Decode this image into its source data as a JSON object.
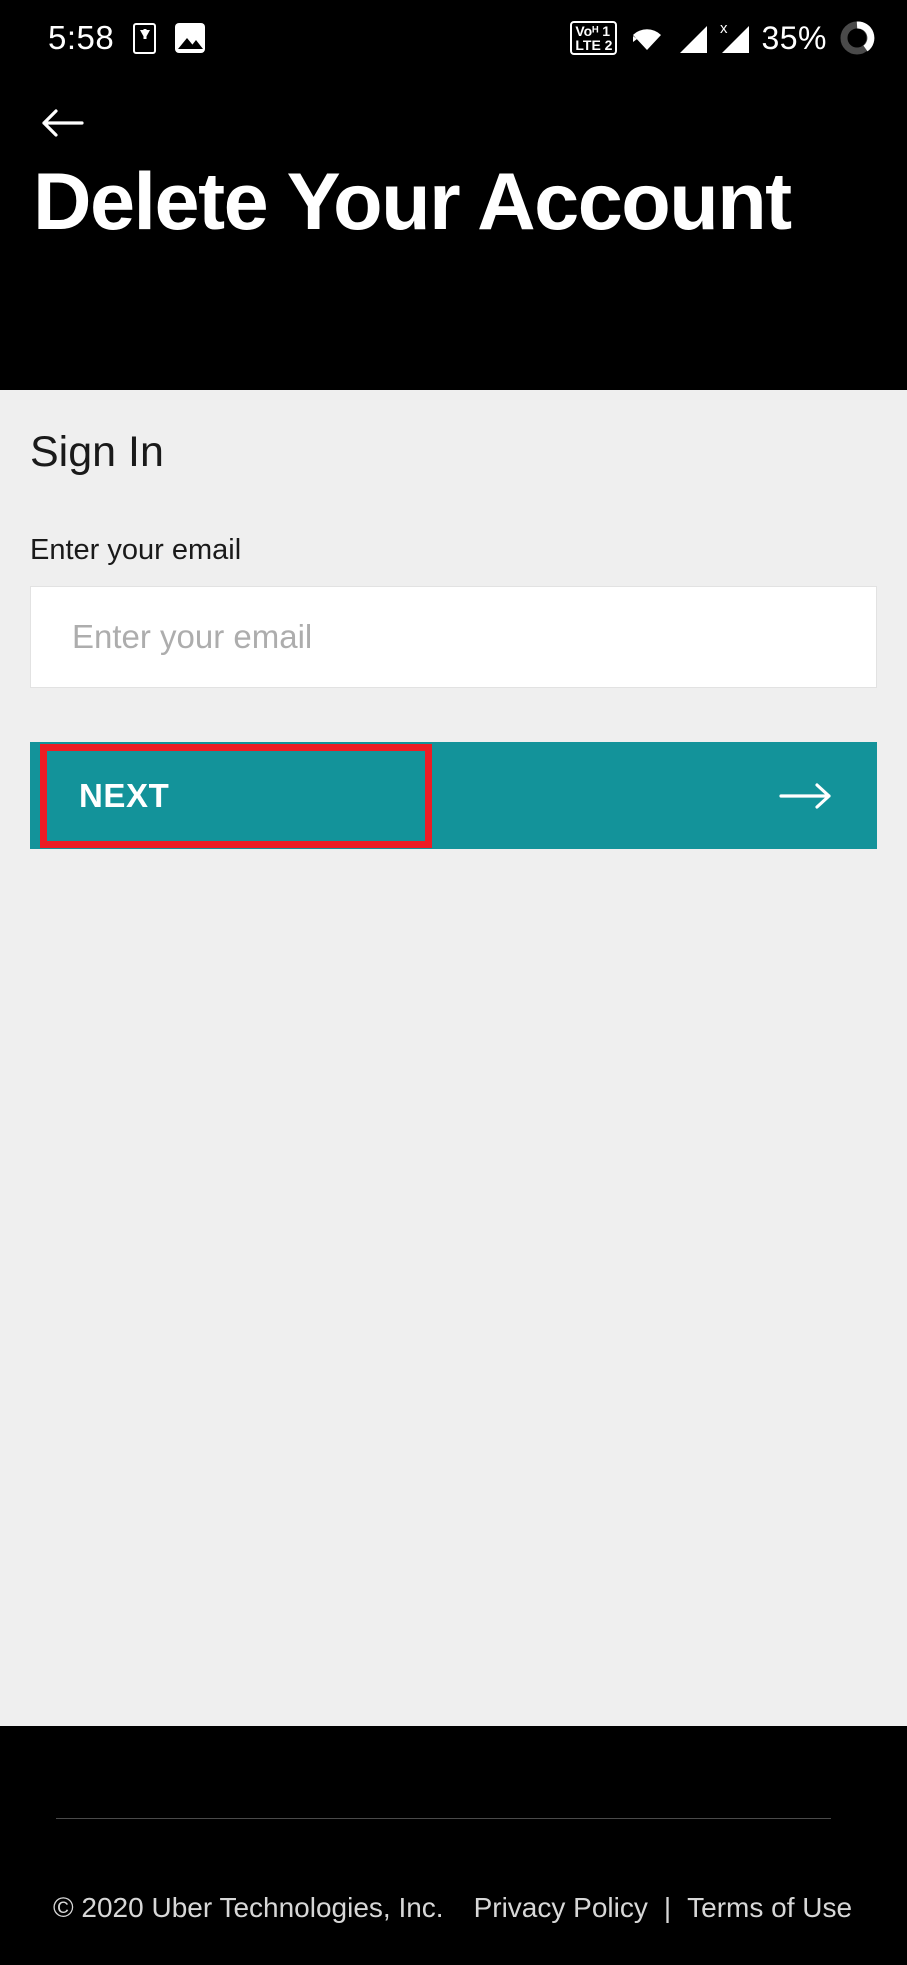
{
  "status_bar": {
    "time": "5:58",
    "icons_left": [
      "download-to-device-icon",
      "image-icon"
    ],
    "network": {
      "vo_line": "Voᴴ 1",
      "lte_line": "LTE 2"
    },
    "wifi": "wifi-icon",
    "signal_1": "signal-bars-icon",
    "signal_2": "signal-bars-no-service-icon",
    "signal_2_badge": "x",
    "battery_percent": "35%",
    "battery_ring": "battery-ring-icon"
  },
  "header": {
    "back_label": "back-arrow",
    "title": "Delete Your Account"
  },
  "main": {
    "heading": "Sign In",
    "email_label": "Enter your email",
    "email_value": "",
    "email_placeholder": "Enter your email",
    "next_label": "NEXT",
    "next_arrow": "arrow-right-icon"
  },
  "footer": {
    "copyright": "© 2020 Uber Technologies, Inc.",
    "privacy": "Privacy Policy",
    "separator": "|",
    "terms": "Terms of Use"
  },
  "colors": {
    "header_bg": "#000000",
    "body_bg": "#efefef",
    "accent_teal": "#13939a",
    "highlight_red": "#ed1c24",
    "footer_bg": "#000000"
  }
}
